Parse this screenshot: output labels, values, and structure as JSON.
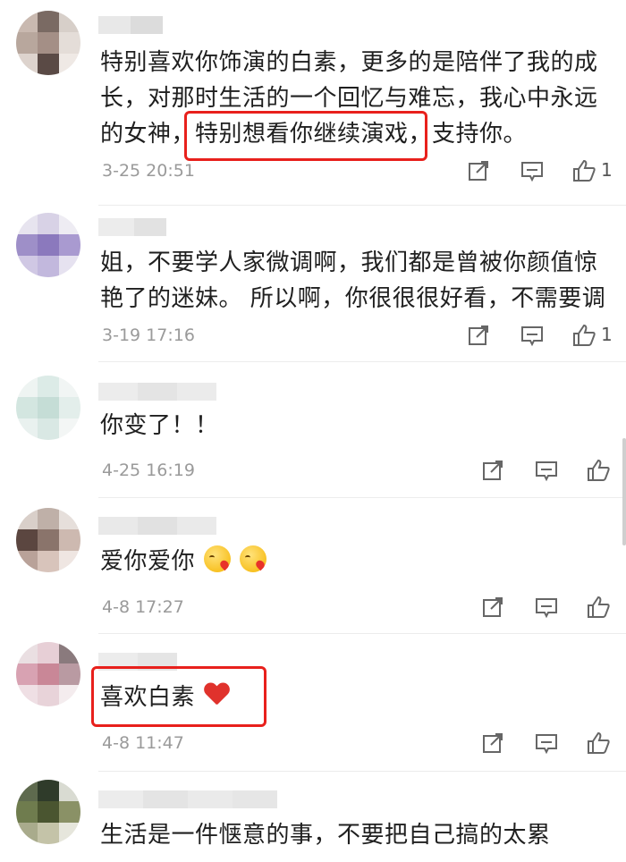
{
  "comments": [
    {
      "text": "特别喜欢你饰演的白素，更多的是陪伴了我的成长，对那时生活的一个回忆与难忘，我心中永远的女神，特别想看你继续演戏，支持你。",
      "text_line1": "特别喜欢你饰演的白素，更多的是陪伴了我的成",
      "text_line2": "长，对那时生活的一个回忆与难忘，我心中永远",
      "text_line3a": "的女神，",
      "text_line3b": "特别想看你继续演戏，",
      "text_line3c": "支持你。",
      "time": "3-25 20:51",
      "likes": "1"
    },
    {
      "text_line1": "姐，不要学人家微调啊，我们都是曾被你颜值惊",
      "text_line2": "艳了的迷妹。 所以啊，你很很很好看，不需要调",
      "time": "3-19 17:16",
      "likes": "1"
    },
    {
      "text_line1": "你变了！！",
      "time": "4-25 16:19"
    },
    {
      "text_line1": "爱你爱你",
      "time": "4-8 17:27"
    },
    {
      "text_line1": "喜欢白素",
      "time": "4-8 11:47"
    },
    {
      "text_line1": "生活是一件惬意的事，不要把自己搞的太累"
    }
  ],
  "icons": {
    "share": "share-icon",
    "reply": "reply-icon",
    "like": "thumbs-up-icon"
  },
  "colors": {
    "highlight": "#e8201c",
    "timestamp": "#9a9a9a"
  }
}
